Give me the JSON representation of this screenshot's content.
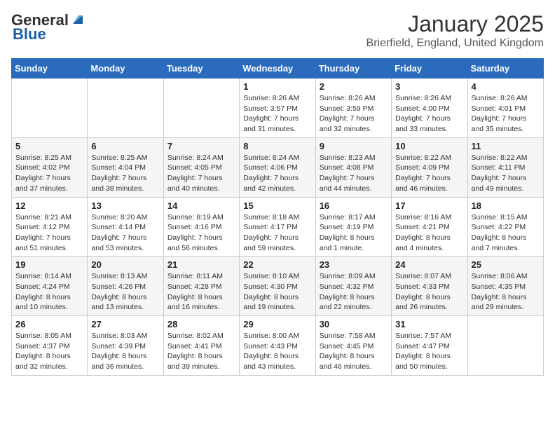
{
  "logo": {
    "line1": "General",
    "line2": "Blue"
  },
  "title": "January 2025",
  "subtitle": "Brierfield, England, United Kingdom",
  "weekdays": [
    "Sunday",
    "Monday",
    "Tuesday",
    "Wednesday",
    "Thursday",
    "Friday",
    "Saturday"
  ],
  "weeks": [
    [
      {
        "day": "",
        "info": ""
      },
      {
        "day": "",
        "info": ""
      },
      {
        "day": "",
        "info": ""
      },
      {
        "day": "1",
        "info": "Sunrise: 8:26 AM\nSunset: 3:57 PM\nDaylight: 7 hours and 31 minutes."
      },
      {
        "day": "2",
        "info": "Sunrise: 8:26 AM\nSunset: 3:59 PM\nDaylight: 7 hours and 32 minutes."
      },
      {
        "day": "3",
        "info": "Sunrise: 8:26 AM\nSunset: 4:00 PM\nDaylight: 7 hours and 33 minutes."
      },
      {
        "day": "4",
        "info": "Sunrise: 8:26 AM\nSunset: 4:01 PM\nDaylight: 7 hours and 35 minutes."
      }
    ],
    [
      {
        "day": "5",
        "info": "Sunrise: 8:25 AM\nSunset: 4:02 PM\nDaylight: 7 hours and 37 minutes."
      },
      {
        "day": "6",
        "info": "Sunrise: 8:25 AM\nSunset: 4:04 PM\nDaylight: 7 hours and 38 minutes."
      },
      {
        "day": "7",
        "info": "Sunrise: 8:24 AM\nSunset: 4:05 PM\nDaylight: 7 hours and 40 minutes."
      },
      {
        "day": "8",
        "info": "Sunrise: 8:24 AM\nSunset: 4:06 PM\nDaylight: 7 hours and 42 minutes."
      },
      {
        "day": "9",
        "info": "Sunrise: 8:23 AM\nSunset: 4:08 PM\nDaylight: 7 hours and 44 minutes."
      },
      {
        "day": "10",
        "info": "Sunrise: 8:22 AM\nSunset: 4:09 PM\nDaylight: 7 hours and 46 minutes."
      },
      {
        "day": "11",
        "info": "Sunrise: 8:22 AM\nSunset: 4:11 PM\nDaylight: 7 hours and 49 minutes."
      }
    ],
    [
      {
        "day": "12",
        "info": "Sunrise: 8:21 AM\nSunset: 4:12 PM\nDaylight: 7 hours and 51 minutes."
      },
      {
        "day": "13",
        "info": "Sunrise: 8:20 AM\nSunset: 4:14 PM\nDaylight: 7 hours and 53 minutes."
      },
      {
        "day": "14",
        "info": "Sunrise: 8:19 AM\nSunset: 4:16 PM\nDaylight: 7 hours and 56 minutes."
      },
      {
        "day": "15",
        "info": "Sunrise: 8:18 AM\nSunset: 4:17 PM\nDaylight: 7 hours and 59 minutes."
      },
      {
        "day": "16",
        "info": "Sunrise: 8:17 AM\nSunset: 4:19 PM\nDaylight: 8 hours and 1 minute."
      },
      {
        "day": "17",
        "info": "Sunrise: 8:16 AM\nSunset: 4:21 PM\nDaylight: 8 hours and 4 minutes."
      },
      {
        "day": "18",
        "info": "Sunrise: 8:15 AM\nSunset: 4:22 PM\nDaylight: 8 hours and 7 minutes."
      }
    ],
    [
      {
        "day": "19",
        "info": "Sunrise: 8:14 AM\nSunset: 4:24 PM\nDaylight: 8 hours and 10 minutes."
      },
      {
        "day": "20",
        "info": "Sunrise: 8:13 AM\nSunset: 4:26 PM\nDaylight: 8 hours and 13 minutes."
      },
      {
        "day": "21",
        "info": "Sunrise: 8:11 AM\nSunset: 4:28 PM\nDaylight: 8 hours and 16 minutes."
      },
      {
        "day": "22",
        "info": "Sunrise: 8:10 AM\nSunset: 4:30 PM\nDaylight: 8 hours and 19 minutes."
      },
      {
        "day": "23",
        "info": "Sunrise: 8:09 AM\nSunset: 4:32 PM\nDaylight: 8 hours and 22 minutes."
      },
      {
        "day": "24",
        "info": "Sunrise: 8:07 AM\nSunset: 4:33 PM\nDaylight: 8 hours and 26 minutes."
      },
      {
        "day": "25",
        "info": "Sunrise: 8:06 AM\nSunset: 4:35 PM\nDaylight: 8 hours and 29 minutes."
      }
    ],
    [
      {
        "day": "26",
        "info": "Sunrise: 8:05 AM\nSunset: 4:37 PM\nDaylight: 8 hours and 32 minutes."
      },
      {
        "day": "27",
        "info": "Sunrise: 8:03 AM\nSunset: 4:39 PM\nDaylight: 8 hours and 36 minutes."
      },
      {
        "day": "28",
        "info": "Sunrise: 8:02 AM\nSunset: 4:41 PM\nDaylight: 8 hours and 39 minutes."
      },
      {
        "day": "29",
        "info": "Sunrise: 8:00 AM\nSunset: 4:43 PM\nDaylight: 8 hours and 43 minutes."
      },
      {
        "day": "30",
        "info": "Sunrise: 7:58 AM\nSunset: 4:45 PM\nDaylight: 8 hours and 46 minutes."
      },
      {
        "day": "31",
        "info": "Sunrise: 7:57 AM\nSunset: 4:47 PM\nDaylight: 8 hours and 50 minutes."
      },
      {
        "day": "",
        "info": ""
      }
    ]
  ]
}
